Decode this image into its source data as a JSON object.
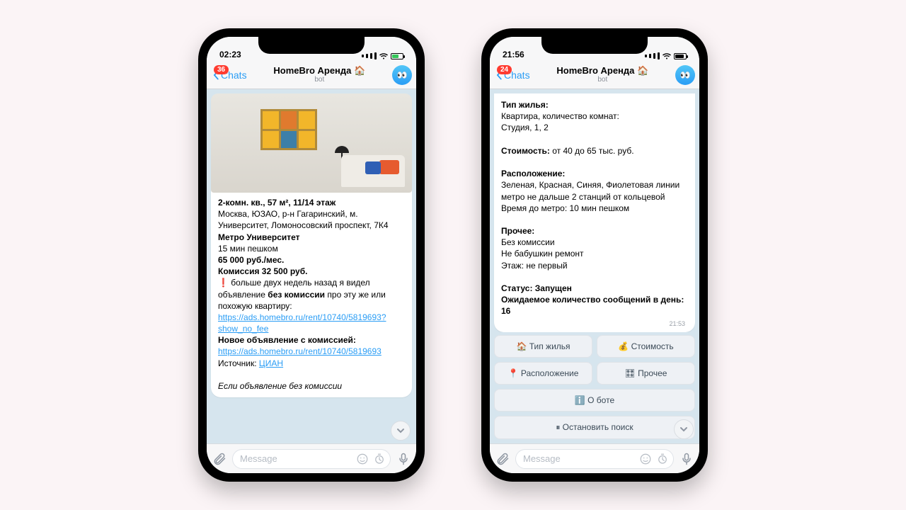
{
  "phone1": {
    "status": {
      "time": "02:23",
      "battery_pct": 55
    },
    "header": {
      "back": "Chats",
      "badge": "36",
      "title": "HomeBro Аренда 🏠",
      "subtitle": "bot"
    },
    "msg": {
      "title_line": "2-комн. кв., 57 м², 11/14 этаж",
      "addr": "Москва, ЮЗАО, р-н Гагаринский, м. Университет, Ломоносовский проспект, 7К4",
      "metro": "Метро Университет",
      "walk": "15 мин пешком",
      "price": "65 000 руб./мес.",
      "fee": "Комиссия 32 500 руб.",
      "warn_pre": "больше двух недель назад я видел объявление",
      "warn_bold": "без комиссии",
      "warn_post": "про эту же или похожую квартиру:",
      "link1": "https://ads.homebro.ru/rent/10740/5819693?show_no_fee",
      "new_lbl": "Новое объявление с комиссией:",
      "link2": "https://ads.homebro.ru/rent/10740/5819693",
      "src_lbl": "Источник:",
      "src_val": "ЦИАН",
      "italic": "Если объявление без комиссии"
    },
    "input": {
      "placeholder": "Message"
    }
  },
  "phone2": {
    "status": {
      "time": "21:56",
      "battery_pct": 72
    },
    "header": {
      "back": "Chats",
      "badge": "24",
      "title": "HomeBro Аренда 🏠",
      "subtitle": "bot"
    },
    "msg": {
      "type_h": "Тип жилья:",
      "type_v1": "Квартира, количество комнат:",
      "type_v2": "Студия, 1, 2",
      "cost_h": "Стоимость:",
      "cost_v": "от 40 до 65 тыс. руб.",
      "loc_h": "Расположение:",
      "loc_v1": "Зеленая, Красная, Синяя, Фиолетовая линии метро не дальше 2 станций от кольцевой",
      "loc_v2": "Время до метро: 10 мин пешком",
      "other_h": "Прочее:",
      "other_v1": "Без комиссии",
      "other_v2": "Не бабушкин ремонт",
      "other_v3": "Этаж: не первый",
      "status_line": "Статус: Запущен",
      "expect": "Ожидаемое количество сообщений в день: 16",
      "ts": "21:53"
    },
    "buttons": {
      "type": "🏠 Тип жилья",
      "cost": "💰 Стоимость",
      "loc": "📍 Расположение",
      "other": "🎛 Прочее",
      "about": "ℹ️ О боте",
      "stop": "⏸ Остановить поиск"
    },
    "input": {
      "placeholder": "Message"
    }
  }
}
